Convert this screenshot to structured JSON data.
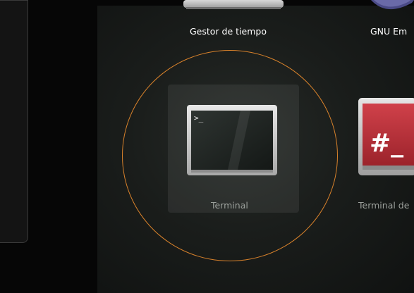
{
  "apps": {
    "gestor": {
      "label": "Gestor de tiempo",
      "icon": "clock-app-icon"
    },
    "emacs": {
      "label": "GNU Em",
      "icon": "emacs-icon"
    },
    "terminal": {
      "label": "Terminal",
      "icon": "terminal-icon",
      "prompt": ">_"
    },
    "terminal_root": {
      "label": "Terminal de",
      "icon": "root-terminal-icon",
      "symbol": "#_"
    }
  },
  "dock": {
    "icons": [
      "toggle-icon",
      "window-icon",
      "red-app-icon",
      "home-folder-icon",
      "printer-icon",
      "notes-icon"
    ]
  },
  "colors": {
    "highlight": "#d9822b",
    "root_terminal_red": "#b8323a",
    "background": "#1a1d1b"
  }
}
